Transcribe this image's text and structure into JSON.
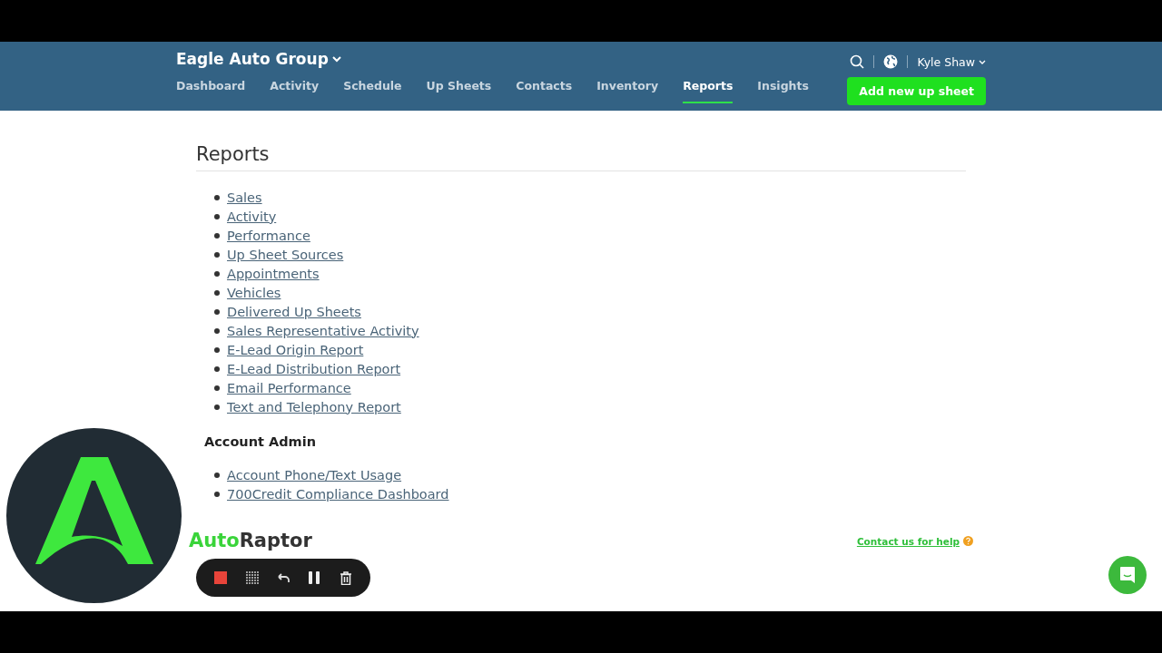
{
  "header": {
    "org": "Eagle Auto Group",
    "user": "Kyle Shaw",
    "action": "Add new up sheet",
    "nav": [
      {
        "label": "Dashboard",
        "selected": false
      },
      {
        "label": "Activity",
        "selected": false
      },
      {
        "label": "Schedule",
        "selected": false
      },
      {
        "label": "Up Sheets",
        "selected": false
      },
      {
        "label": "Contacts",
        "selected": false
      },
      {
        "label": "Inventory",
        "selected": false
      },
      {
        "label": "Reports",
        "selected": true
      },
      {
        "label": "Insights",
        "selected": false
      }
    ]
  },
  "page": {
    "title": "Reports",
    "reports": [
      "Sales",
      "Activity",
      "Performance",
      "Up Sheet Sources",
      "Appointments",
      "Vehicles",
      "Delivered Up Sheets",
      "Sales Representative Activity",
      "E-Lead Origin Report",
      "E-Lead Distribution Report",
      "Email Performance",
      "Text and Telephony Report"
    ],
    "admin_title": "Account Admin",
    "admin": [
      "Account Phone/Text Usage",
      "700Credit Compliance Dashboard"
    ]
  },
  "footer": {
    "brand_left": "Auto",
    "brand_right": "Raptor",
    "help": "Contact us for help"
  }
}
